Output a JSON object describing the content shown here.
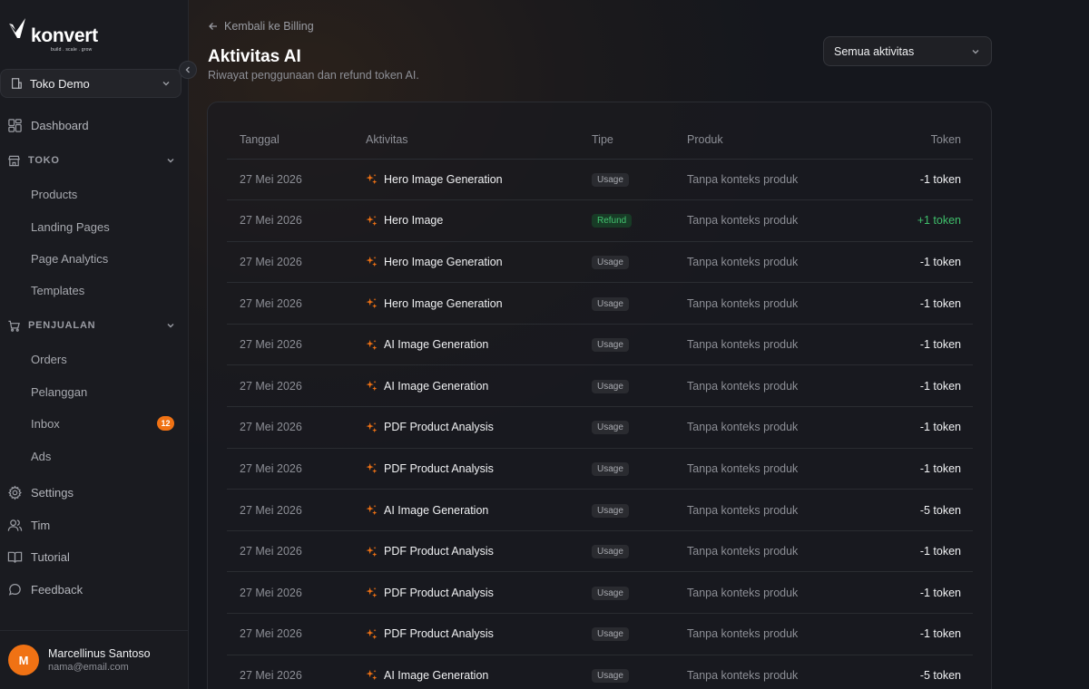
{
  "sidebar": {
    "logo_text": "konvert",
    "logo_tagline": "build . scale . grow",
    "store": "Toko Demo",
    "dashboard": "Dashboard",
    "section_toko": "TOKO",
    "toko_items": [
      "Products",
      "Landing Pages",
      "Page Analytics",
      "Templates"
    ],
    "section_penjualan": "PENJUALAN",
    "penjualan_items": [
      "Orders",
      "Pelanggan",
      "Inbox",
      "Ads"
    ],
    "inbox_badge": "12",
    "bottom_items": [
      "Settings",
      "Tim",
      "Tutorial",
      "Feedback"
    ],
    "user": {
      "initial": "M",
      "name": "Marcellinus Santoso",
      "email": "nama@email.com"
    }
  },
  "header": {
    "back_label": "Kembali ke Billing",
    "title": "Aktivitas AI",
    "subtitle": "Riwayat penggunaan dan refund token AI.",
    "filter_value": "Semua aktivitas"
  },
  "table": {
    "columns": [
      "Tanggal",
      "Aktivitas",
      "Tipe",
      "Produk",
      "Token"
    ],
    "rows": [
      {
        "date": "27 Mei 2026",
        "activity": "Hero Image Generation",
        "type": "Usage",
        "product": "Tanpa konteks produk",
        "token": "-1 token"
      },
      {
        "date": "27 Mei 2026",
        "activity": "Hero Image",
        "type": "Refund",
        "product": "Tanpa konteks produk",
        "token": "+1 token"
      },
      {
        "date": "27 Mei 2026",
        "activity": "Hero Image Generation",
        "type": "Usage",
        "product": "Tanpa konteks produk",
        "token": "-1 token"
      },
      {
        "date": "27 Mei 2026",
        "activity": "Hero Image Generation",
        "type": "Usage",
        "product": "Tanpa konteks produk",
        "token": "-1 token"
      },
      {
        "date": "27 Mei 2026",
        "activity": "AI Image Generation",
        "type": "Usage",
        "product": "Tanpa konteks produk",
        "token": "-1 token"
      },
      {
        "date": "27 Mei 2026",
        "activity": "AI Image Generation",
        "type": "Usage",
        "product": "Tanpa konteks produk",
        "token": "-1 token"
      },
      {
        "date": "27 Mei 2026",
        "activity": "PDF Product Analysis",
        "type": "Usage",
        "product": "Tanpa konteks produk",
        "token": "-1 token"
      },
      {
        "date": "27 Mei 2026",
        "activity": "PDF Product Analysis",
        "type": "Usage",
        "product": "Tanpa konteks produk",
        "token": "-1 token"
      },
      {
        "date": "27 Mei 2026",
        "activity": "AI Image Generation",
        "type": "Usage",
        "product": "Tanpa konteks produk",
        "token": "-5 token"
      },
      {
        "date": "27 Mei 2026",
        "activity": "PDF Product Analysis",
        "type": "Usage",
        "product": "Tanpa konteks produk",
        "token": "-1 token"
      },
      {
        "date": "27 Mei 2026",
        "activity": "PDF Product Analysis",
        "type": "Usage",
        "product": "Tanpa konteks produk",
        "token": "-1 token"
      },
      {
        "date": "27 Mei 2026",
        "activity": "PDF Product Analysis",
        "type": "Usage",
        "product": "Tanpa konteks produk",
        "token": "-1 token"
      },
      {
        "date": "27 Mei 2026",
        "activity": "AI Image Generation",
        "type": "Usage",
        "product": "Tanpa konteks produk",
        "token": "-5 token"
      }
    ]
  },
  "colors": {
    "accent": "#f07214",
    "refund": "#3fbf6b",
    "background": "#15171d"
  },
  "icons": {
    "activity": "sparkle-icon",
    "back": "arrow-left-icon",
    "store": "building-icon",
    "dashboard": "grid-icon",
    "toko": "store-icon",
    "penjualan": "cart-icon",
    "settings": "gear-icon",
    "tim": "users-icon",
    "tutorial": "book-icon",
    "feedback": "chat-bubble-icon"
  }
}
